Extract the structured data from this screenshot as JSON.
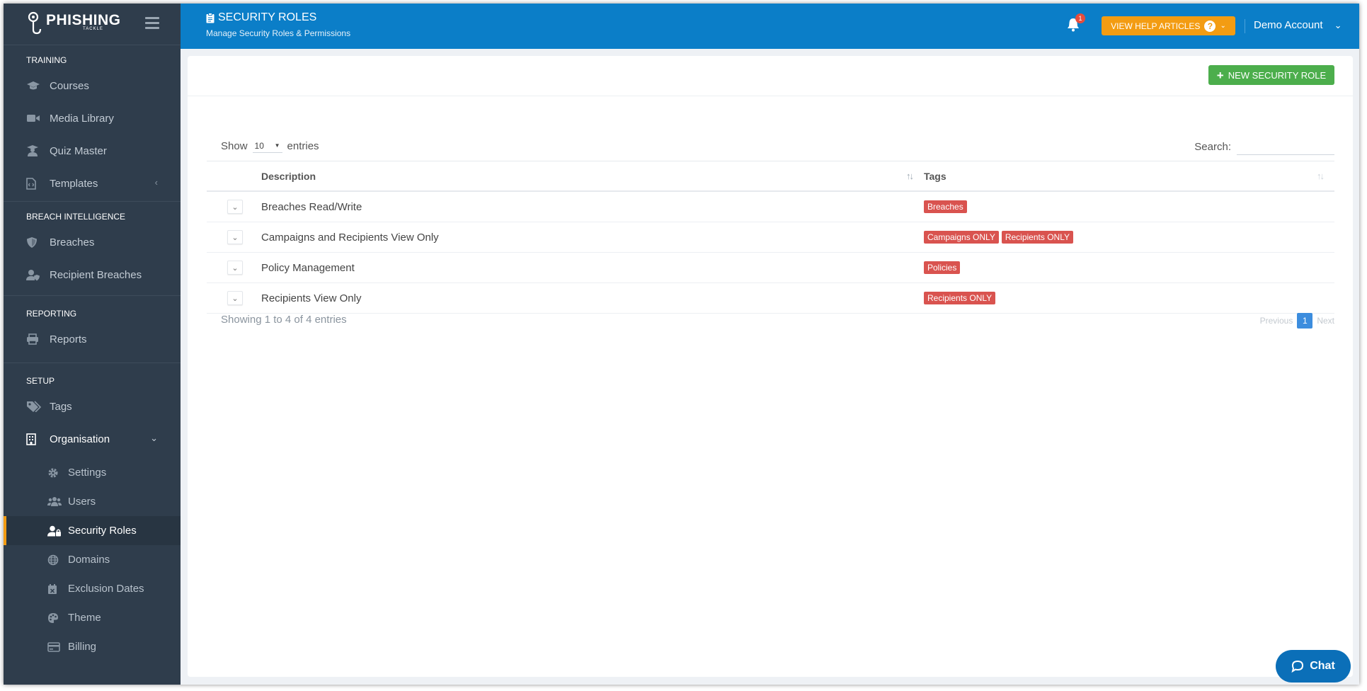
{
  "app": {
    "logo_text": "PHISHING",
    "logo_subtext": "TACKLE"
  },
  "header": {
    "title": "SECURITY ROLES",
    "subtitle": "Manage Security Roles & Permissions",
    "notification_count": "1",
    "help_label": "VIEW HELP ARTICLES",
    "account_label": "Demo Account"
  },
  "sidebar": {
    "sections": [
      {
        "title": "TRAINING",
        "items": [
          {
            "label": "Courses",
            "icon": "graduation-cap-icon"
          },
          {
            "label": "Media Library",
            "icon": "video-camera-icon"
          },
          {
            "label": "Quiz Master",
            "icon": "user-graduate-icon"
          },
          {
            "label": "Templates",
            "icon": "file-code-icon"
          }
        ]
      },
      {
        "title": "BREACH INTELLIGENCE",
        "items": [
          {
            "label": "Breaches",
            "icon": "shield-icon"
          },
          {
            "label": "Recipient Breaches",
            "icon": "user-shield-icon"
          }
        ]
      },
      {
        "title": "REPORTING",
        "items": [
          {
            "label": "Reports",
            "icon": "printer-icon"
          }
        ]
      },
      {
        "title": "SETUP",
        "items": [
          {
            "label": "Tags",
            "icon": "tags-icon"
          },
          {
            "label": "Organisation",
            "icon": "building-icon"
          }
        ]
      }
    ],
    "organisation_sub_items": [
      {
        "label": "Settings",
        "icon": "gear-icon"
      },
      {
        "label": "Users",
        "icon": "users-icon"
      },
      {
        "label": "Security Roles",
        "icon": "user-lock-icon",
        "active": true
      },
      {
        "label": "Domains",
        "icon": "globe-icon"
      },
      {
        "label": "Exclusion Dates",
        "icon": "calendar-x-icon"
      },
      {
        "label": "Theme",
        "icon": "palette-icon"
      },
      {
        "label": "Billing",
        "icon": "credit-card-icon"
      }
    ]
  },
  "toolbar": {
    "new_role_label": "NEW SECURITY ROLE"
  },
  "table_controls": {
    "show_label": "Show",
    "page_length": "10",
    "entries_label": "entries",
    "search_label": "Search:",
    "search_value": ""
  },
  "table": {
    "columns": [
      "Description",
      "Tags"
    ],
    "rows": [
      {
        "description": "Breaches Read/Write",
        "tags": [
          "Breaches"
        ]
      },
      {
        "description": "Campaigns and Recipients View Only",
        "tags": [
          "Campaigns ONLY",
          "Recipients ONLY"
        ]
      },
      {
        "description": "Policy Management",
        "tags": [
          "Policies"
        ]
      },
      {
        "description": "Recipients View Only",
        "tags": [
          "Recipients ONLY"
        ]
      }
    ]
  },
  "footer": {
    "info": "Showing 1 to 4 of 4 entries",
    "previous_label": "Previous",
    "current_page": "1",
    "next_label": "Next"
  },
  "chat": {
    "label": "Chat"
  },
  "colors": {
    "header_bg": "#0b7ec8",
    "sidebar_bg": "#2f3d4c",
    "accent_orange": "#f39c12",
    "success_green": "#4cae4c",
    "tag_red": "#d9534f"
  }
}
